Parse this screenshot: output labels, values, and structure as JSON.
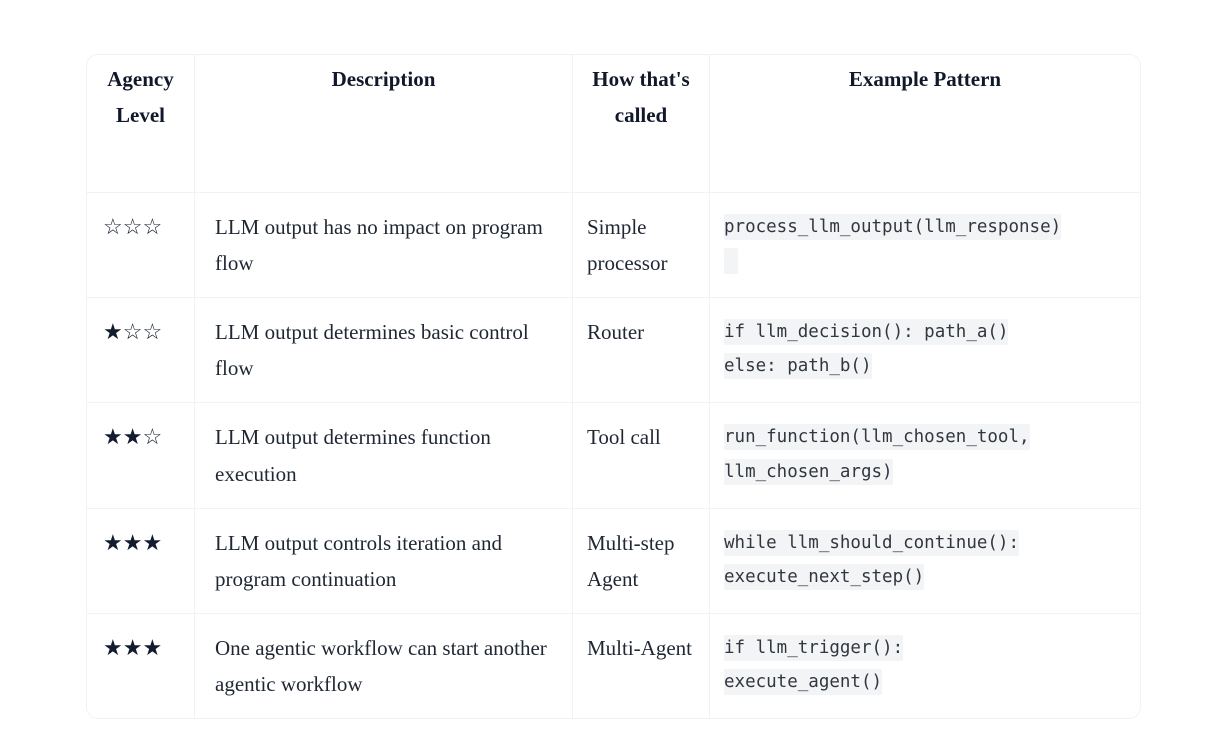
{
  "table": {
    "columns": [
      {
        "key": "agency_level",
        "label": "Agency Level"
      },
      {
        "key": "description",
        "label": "Description"
      },
      {
        "key": "how_called",
        "label": "How that's called"
      },
      {
        "key": "example_pattern",
        "label": "Example Pattern"
      }
    ],
    "header": {
      "agency_level": "Agency Level",
      "description": "Description",
      "how_called": "How that's called",
      "example_pattern": "Example Pattern"
    },
    "rows": [
      {
        "stars": "☆☆☆",
        "stars_filled": 0,
        "stars_total": 3,
        "description": "LLM output has no impact on program flow",
        "how_called": "Simple processor",
        "code_lines": [
          "process_llm_output(llm_response)",
          " "
        ]
      },
      {
        "stars": "★☆☆",
        "stars_filled": 1,
        "stars_total": 3,
        "description": "LLM output determines basic control flow",
        "how_called": "Router",
        "code_lines": [
          "if llm_decision(): path_a()",
          "else: path_b()"
        ]
      },
      {
        "stars": "★★☆",
        "stars_filled": 2,
        "stars_total": 3,
        "description": "LLM output determines function execution",
        "how_called": "Tool call",
        "code_lines": [
          "run_function(llm_chosen_tool,",
          "llm_chosen_args)"
        ]
      },
      {
        "stars": "★★★",
        "stars_filled": 3,
        "stars_total": 3,
        "description": "LLM output controls iteration and program continuation",
        "how_called": "Multi-step Agent",
        "code_lines": [
          "while llm_should_continue():",
          "execute_next_step()"
        ]
      },
      {
        "stars": "★★★",
        "stars_filled": 3,
        "stars_total": 3,
        "description": "One agentic workflow can start another agentic workflow",
        "how_called": "Multi-Agent",
        "code_lines": [
          "if llm_trigger():",
          "execute_agent()"
        ]
      }
    ]
  },
  "colors": {
    "page_background": "#ffffff",
    "table_border": "#f1f2f4",
    "header_text": "#10182a",
    "body_text": "#1f2733",
    "star": "#131c2e",
    "code_background": "#f3f4f6",
    "code_text": "#32363f"
  }
}
